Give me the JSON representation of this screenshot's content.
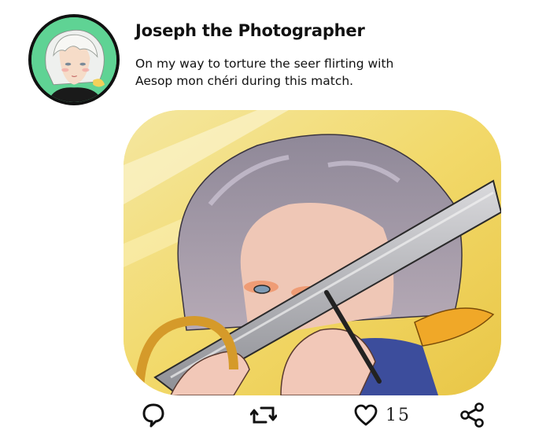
{
  "post": {
    "username": "Joseph the Photographer",
    "text": "On my way to torture the seer flirting with Aesop mon chéri during this match."
  },
  "actions": {
    "reply_icon": "speech-bubble-icon",
    "repost_icon": "repost-arrows-icon",
    "like_icon": "heart-icon",
    "like_count": "15",
    "share_icon": "share-nodes-icon"
  },
  "colors": {
    "avatar_bg": "#5fd394",
    "media_bg": "#f1dc6a",
    "outline": "#111111"
  }
}
